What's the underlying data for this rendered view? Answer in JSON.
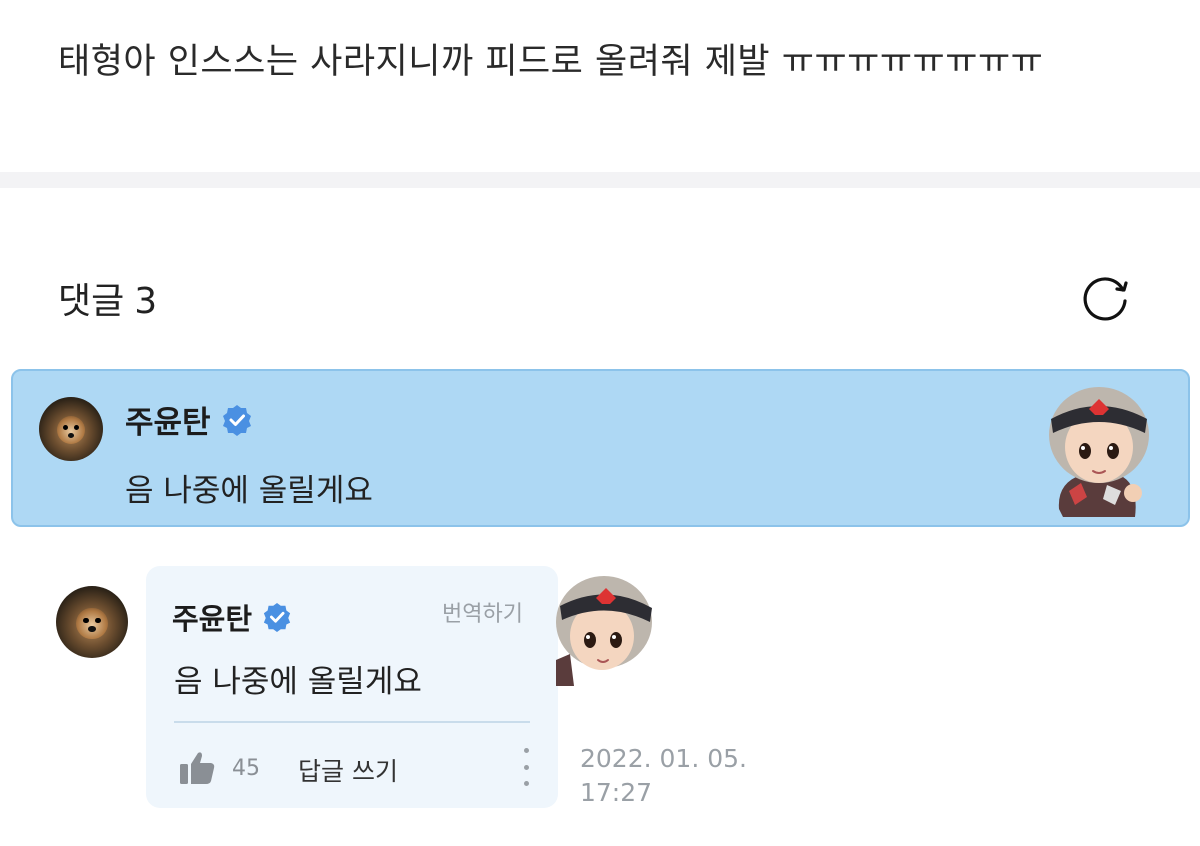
{
  "post": {
    "text": "태형아 인스스는 사라지니까 피드로 올려줘 제발 ㅠㅠㅠㅠㅠㅠㅠㅠ"
  },
  "comments_header": {
    "label": "댓글",
    "count": "3"
  },
  "highlighted_comment": {
    "author": "주윤탄",
    "text": "음 나중에 올릴게요"
  },
  "reply_comment": {
    "author": "주윤탄",
    "text": "음 나중에 올릴게요",
    "translate_label": "번역하기",
    "like_count": "45",
    "reply_label": "답글 쓰기",
    "date": "2022. 01. 05.",
    "time": "17:27"
  },
  "colors": {
    "highlight_bg": "#aed8f4",
    "verified_blue": "#4a90e2",
    "bubble_bg": "#eff6fc"
  },
  "icons": [
    "refresh-icon",
    "verified-badge-icon",
    "thumbs-up-icon",
    "more-vertical-icon"
  ]
}
